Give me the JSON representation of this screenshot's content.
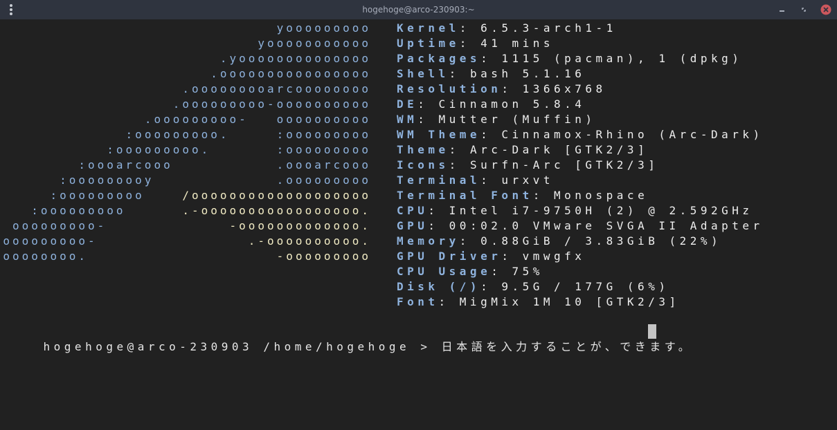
{
  "window": {
    "title": "hogehoge@arco-230903:~",
    "menu_icon": "kebab-menu-icon",
    "minimize_icon": "minimize-icon",
    "maximize_icon": "maximize-icon",
    "close_icon": "close-icon",
    "close_color": "#cc575d"
  },
  "colors": {
    "background": "#212121",
    "logo_dark": "#8fb3de",
    "logo_light": "#f1ebc4",
    "info_key": "#8fb3de",
    "highlight": "#8fde75"
  },
  "logo": [
    [
      {
        "t": "yooooooooo",
        "c": "dk"
      }
    ],
    [
      {
        "t": "yooooooooooo",
        "c": "dk"
      }
    ],
    [
      {
        "t": ".yoooooooooooooo",
        "c": "dk"
      }
    ],
    [
      {
        "t": ".oooooooooooooooo",
        "c": "dk"
      }
    ],
    [
      {
        "t": ".ooooooooarcoooooooo",
        "c": "dk"
      }
    ],
    [
      {
        "t": ".ooooooooo-oooooooooo",
        "c": "dk"
      }
    ],
    [
      {
        "t": ".ooooooooo-   oooooooooo",
        "c": "dk"
      }
    ],
    [
      {
        "t": ":ooooooooo.     :ooooooooo",
        "c": "dk"
      }
    ],
    [
      {
        "t": ":ooooooooo.       :ooooooooo",
        "c": "dk"
      }
    ],
    [
      {
        "t": ":oooarcooo           .oooarcooo",
        "c": "dk"
      }
    ],
    [
      {
        "t": ":ooooooooy             .ooooooooo",
        "c": "dk"
      }
    ],
    [
      {
        "t": ":ooooooooo    ",
        "c": "dk"
      },
      {
        "t": "/ooooooooooooooooooo",
        "c": "lt"
      }
    ],
    [
      {
        "t": ":ooooooooo      ",
        "c": "dk"
      },
      {
        "t": ".-ooooooooooooooooo.",
        "c": "lt"
      }
    ],
    [
      {
        "t": "ooooooooo-             ",
        "c": "dk"
      },
      {
        "t": "-ooooooooooooo.",
        "c": "lt"
      }
    ],
    [
      {
        "t": "ooooooooo-                ",
        "c": "dk"
      },
      {
        "t": ".-oooooooooo.",
        "c": "lt"
      }
    ],
    [
      {
        "t": "ooooooooo.                    ",
        "c": "dk"
      },
      {
        "t": "-ooooooooo",
        "c": "lt"
      }
    ]
  ],
  "info": [
    [
      {
        "t": "Kernel",
        "c": "key"
      },
      {
        "t": ": 6.5.3-arch1-1",
        "c": "val"
      }
    ],
    [
      {
        "t": "Uptime",
        "c": "key"
      },
      {
        "t": ": 41 mins",
        "c": "val"
      }
    ],
    [
      {
        "t": "Packages",
        "c": "key"
      },
      {
        "t": ": 1115 (pacman), 1 (dpkg)",
        "c": "val"
      }
    ],
    [
      {
        "t": "Shell",
        "c": "key"
      },
      {
        "t": ": bash 5.1.16",
        "c": "val"
      }
    ],
    [
      {
        "t": "Resolution",
        "c": "key"
      },
      {
        "t": ": 1366x768",
        "c": "val"
      }
    ],
    [
      {
        "t": "DE",
        "c": "key"
      },
      {
        "t": ": Cinnamon 5.8.4",
        "c": "val"
      }
    ],
    [
      {
        "t": "WM",
        "c": "key"
      },
      {
        "t": ": Mutter (Muffin)",
        "c": "val"
      }
    ],
    [
      {
        "t": "WM Theme",
        "c": "key"
      },
      {
        "t": ": Cinnamox-Rhino (Arc-Dark)",
        "c": "val"
      }
    ],
    [
      {
        "t": "Theme",
        "c": "key"
      },
      {
        "t": ": Arc-Dark [GTK2/3]",
        "c": "val"
      }
    ],
    [
      {
        "t": "Icons",
        "c": "key"
      },
      {
        "t": ": Surfn-Arc [GTK2/3]",
        "c": "val"
      }
    ],
    [
      {
        "t": "Terminal",
        "c": "key"
      },
      {
        "t": ": urxvt",
        "c": "val"
      }
    ],
    [
      {
        "t": "Terminal Font",
        "c": "key"
      },
      {
        "t": ": Monospace",
        "c": "val"
      }
    ],
    [
      {
        "t": "CPU",
        "c": "key"
      },
      {
        "t": ": Intel i7-9750H (2) @ 2.592GHz",
        "c": "val"
      }
    ],
    [
      {
        "t": "GPU",
        "c": "key"
      },
      {
        "t": ": 00:02.0 VMware SVGA II Adapter",
        "c": "val"
      }
    ],
    [
      {
        "t": "Memory",
        "c": "key"
      },
      {
        "t": ": 0.88GiB / 3.83GiB (22%)",
        "c": "val"
      }
    ],
    [
      {
        "t": "GPU Driver",
        "c": "key"
      },
      {
        "t": ": vmwgfx",
        "c": "val"
      }
    ],
    [
      {
        "t": "CPU Usage",
        "c": "key"
      },
      {
        "t": ": 75%",
        "c": "val"
      }
    ],
    [
      {
        "t": "Disk (/)",
        "c": "key"
      },
      {
        "t": ": 9.5G / 177G (6%)",
        "c": "val"
      }
    ],
    [
      {
        "t": "Font",
        "c": "key"
      },
      {
        "t": ": MigMix 1M 10 [GTK2/3]",
        "c": "val"
      }
    ]
  ],
  "prompt": {
    "user_host": "hogehoge@arco-230903",
    "path": "/home/hogehoge",
    "symbol": ">",
    "input": "日本語を入力することが、できます。"
  }
}
